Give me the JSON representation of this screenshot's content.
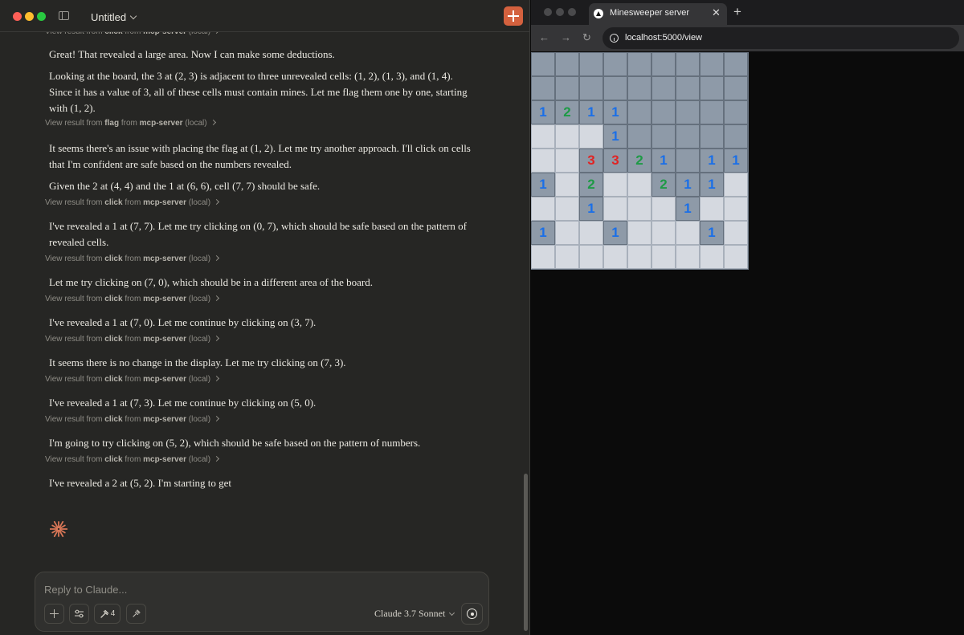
{
  "claude": {
    "window_title": "Untitled",
    "model_label": "Claude 3.7 Sonnet",
    "composer_placeholder": "Reply to Claude...",
    "tools_count": "4",
    "transcript": [
      {
        "kind": "meta",
        "prefix": "View result from ",
        "tool": "click",
        "middle": " from ",
        "server": "mcp-server",
        "suffix": " (local)"
      },
      {
        "kind": "msg",
        "text": "Great! That revealed a large area. Now I can make some deductions."
      },
      {
        "kind": "msg",
        "text": "Looking at the board, the 3 at (2, 3) is adjacent to three unrevealed cells: (1, 2), (1, 3), and (1, 4). Since it has a value of 3, all of these cells must contain mines. Let me flag them one by one, starting with (1, 2)."
      },
      {
        "kind": "meta",
        "prefix": "View result from ",
        "tool": "flag",
        "middle": " from ",
        "server": "mcp-server",
        "suffix": " (local)"
      },
      {
        "kind": "msg",
        "text": "It seems there's an issue with placing the flag at (1, 2). Let me try another approach. I'll click on cells that I'm confident are safe based on the numbers revealed."
      },
      {
        "kind": "msg",
        "text": "Given the 2 at (4, 4) and the 1 at (6, 6), cell (7, 7) should be safe."
      },
      {
        "kind": "meta",
        "prefix": "View result from ",
        "tool": "click",
        "middle": " from ",
        "server": "mcp-server",
        "suffix": " (local)"
      },
      {
        "kind": "msg",
        "text": "I've revealed a 1 at (7, 7). Let me try clicking on (0, 7), which should be safe based on the pattern of revealed cells."
      },
      {
        "kind": "meta",
        "prefix": "View result from ",
        "tool": "click",
        "middle": " from ",
        "server": "mcp-server",
        "suffix": " (local)"
      },
      {
        "kind": "msg",
        "text": "Let me try clicking on (7, 0), which should be in a different area of the board."
      },
      {
        "kind": "meta",
        "prefix": "View result from ",
        "tool": "click",
        "middle": " from ",
        "server": "mcp-server",
        "suffix": " (local)"
      },
      {
        "kind": "msg",
        "text": "I've revealed a 1 at (7, 0). Let me continue by clicking on (3, 7)."
      },
      {
        "kind": "meta",
        "prefix": "View result from ",
        "tool": "click",
        "middle": " from ",
        "server": "mcp-server",
        "suffix": " (local)"
      },
      {
        "kind": "msg",
        "text": "It seems there is no change in the display. Let me try clicking on (7, 3)."
      },
      {
        "kind": "meta",
        "prefix": "View result from ",
        "tool": "click",
        "middle": " from ",
        "server": "mcp-server",
        "suffix": " (local)"
      },
      {
        "kind": "msg",
        "text": "I've revealed a 1 at (7, 3). Let me continue by clicking on (5, 0)."
      },
      {
        "kind": "meta",
        "prefix": "View result from ",
        "tool": "click",
        "middle": " from ",
        "server": "mcp-server",
        "suffix": " (local)"
      },
      {
        "kind": "msg",
        "text": "I'm going to try clicking on (5, 2), which should be safe based on the pattern of numbers."
      },
      {
        "kind": "meta",
        "prefix": "View result from ",
        "tool": "click",
        "middle": " from ",
        "server": "mcp-server",
        "suffix": " (local)"
      },
      {
        "kind": "msg",
        "text": "I've revealed a 2 at (5, 2). I'm starting to get"
      }
    ]
  },
  "browser": {
    "tab_title": "Minesweeper server",
    "url": "localhost:5000/view",
    "board": [
      [
        "h",
        "h",
        "h",
        "h",
        "h",
        "h",
        "h",
        "h",
        "h"
      ],
      [
        "h",
        "h",
        "h",
        "h",
        "h",
        "h",
        "h",
        "h",
        "h"
      ],
      [
        "h1",
        "h2",
        "h1",
        "h1",
        "h",
        "h",
        "h",
        "h",
        "h"
      ],
      [
        "o",
        "o",
        "o",
        "h1",
        "h",
        "h",
        "h",
        "h",
        "h"
      ],
      [
        "o",
        "o",
        "h3",
        "h3",
        "h2",
        "h1",
        "h",
        "h1",
        "h1"
      ],
      [
        "h1",
        "o",
        "h2",
        "o",
        "o",
        "h2",
        "h1",
        "h1",
        "o"
      ],
      [
        "o",
        "o",
        "h1",
        "o",
        "o",
        "o",
        "h1",
        "o",
        "o"
      ],
      [
        "h1",
        "o",
        "o",
        "h1",
        "o",
        "o",
        "o",
        "h1",
        "o"
      ],
      [
        "o",
        "o",
        "o",
        "o",
        "o",
        "o",
        "o",
        "o",
        "o"
      ]
    ],
    "colors": {
      "one": "#1a6fe8",
      "two": "#1e9a46",
      "three": "#e02424"
    }
  }
}
